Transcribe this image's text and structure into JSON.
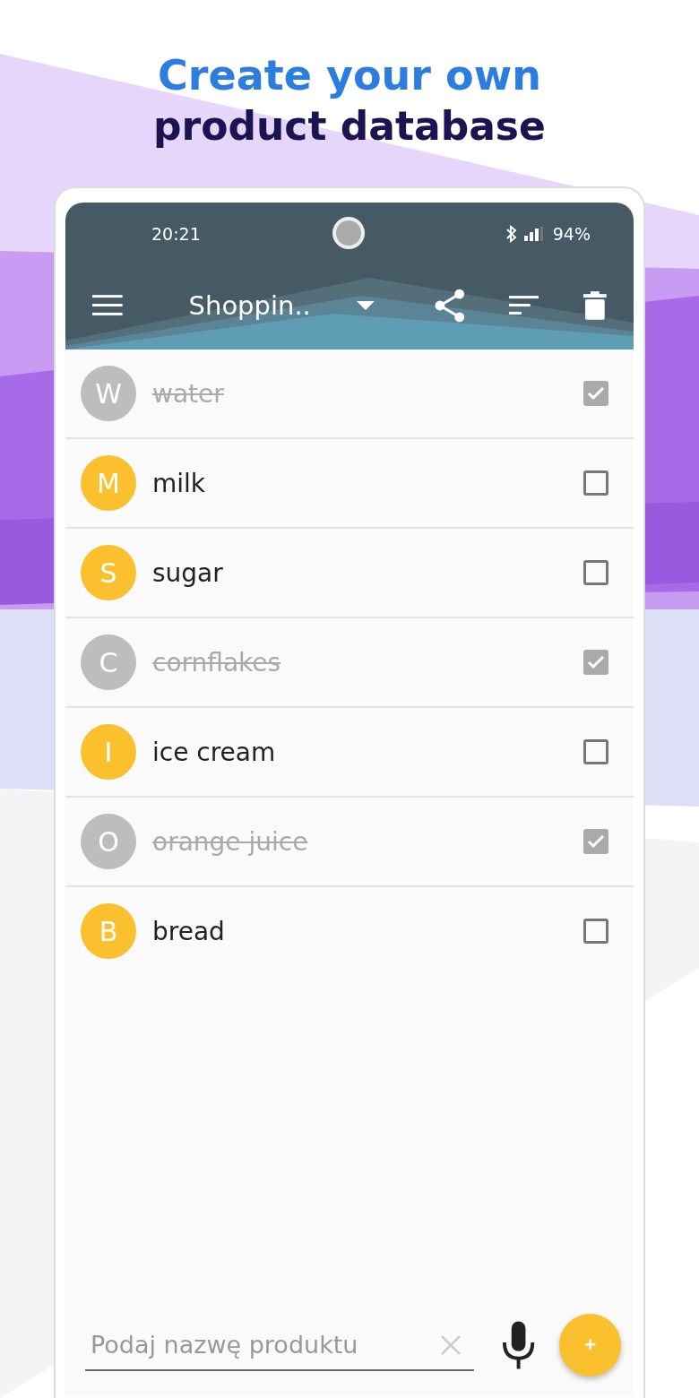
{
  "headline": {
    "line_1": "Create your own",
    "line_2": "product database"
  },
  "status_bar": {
    "time": "20:21",
    "battery": "94%"
  },
  "toolbar": {
    "list_name": "Shoppin.."
  },
  "items": [
    {
      "letter": "W",
      "name": "water",
      "checked": true
    },
    {
      "letter": "M",
      "name": "milk",
      "checked": false
    },
    {
      "letter": "S",
      "name": "sugar",
      "checked": false
    },
    {
      "letter": "C",
      "name": "cornflakes",
      "checked": true
    },
    {
      "letter": "I",
      "name": "ice cream",
      "checked": false
    },
    {
      "letter": "O",
      "name": "orange juice",
      "checked": true
    },
    {
      "letter": "B",
      "name": "bread",
      "checked": false
    }
  ],
  "input": {
    "placeholder": "Podaj nazwę produktu"
  },
  "add_button": {
    "label": "+"
  }
}
